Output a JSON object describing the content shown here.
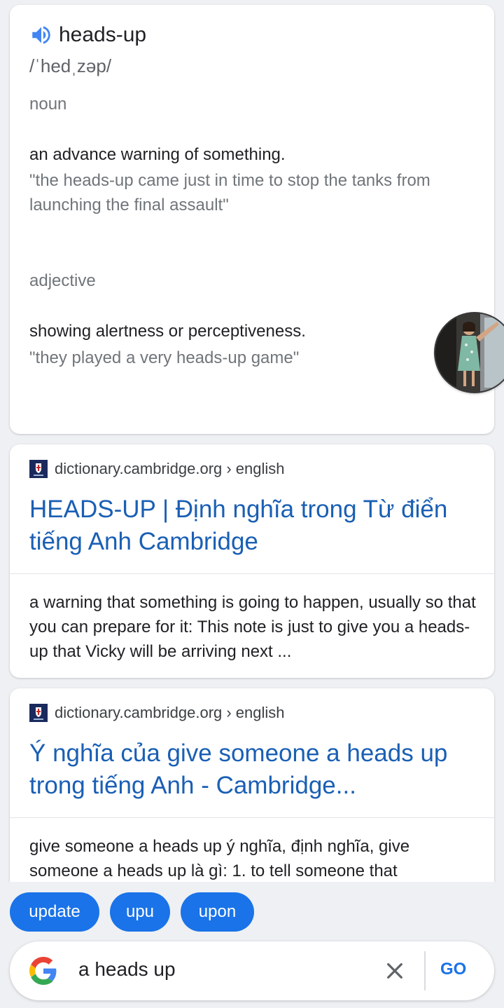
{
  "dictionary": {
    "word": "heads-up",
    "phonetic": "/ˈhedˌzəp/",
    "meanings": [
      {
        "part_of_speech": "noun",
        "definition": "an advance warning of something.",
        "example": "\"the heads-up came just in time to stop the tanks from launching the final assault\""
      },
      {
        "part_of_speech": "adjective",
        "definition": "showing alertness or perceptiveness.",
        "example": "\"they played a very heads-up game\""
      }
    ],
    "speaker_icon": "speaker-icon",
    "accent_color": "#4285f4"
  },
  "results": [
    {
      "source": "dictionary.cambridge.org › english",
      "title": "HEADS-UP | Định nghĩa trong Từ điển tiếng Anh Cambridge",
      "snippet": "a warning that something is going to happen, usually so that you can prepare for it: This note is just to give you a heads-up that Vicky will be arriving next ..."
    },
    {
      "source": "dictionary.cambridge.org › english",
      "title": "Ý nghĩa của give someone a heads up trong tiếng Anh - Cambridge...",
      "snippet": "give someone a heads up ý nghĩa, định nghĩa, give someone a heads up là gì: 1. to tell someone that"
    }
  ],
  "suggestions": [
    "update",
    "upu",
    "upon"
  ],
  "search": {
    "query": "a heads up",
    "go_label": "GO",
    "clear_icon": "close-icon",
    "logo_icon": "google-logo"
  },
  "colors": {
    "link": "#1a5fb4",
    "chip": "#1a73e8",
    "background": "#eef0f3"
  }
}
